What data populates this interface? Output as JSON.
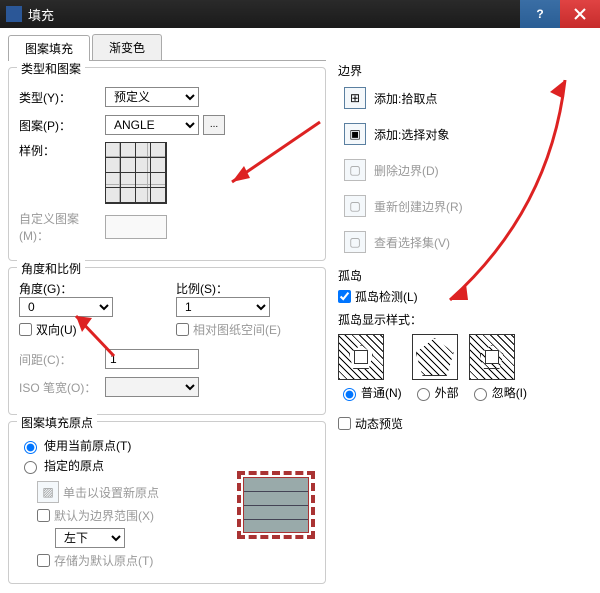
{
  "window": {
    "title": "填充"
  },
  "tabs": {
    "pattern": "图案填充",
    "gradient": "渐变色"
  },
  "group_type": {
    "title": "类型和图案",
    "type_label": "类型(Y)：",
    "type_value": "预定义",
    "pattern_label": "图案(P)：",
    "pattern_value": "ANGLE",
    "sample_label": "样例：",
    "custom_label": "自定义图案(M)："
  },
  "group_angle": {
    "title": "角度和比例",
    "angle_label": "角度(G)：",
    "angle_value": "0",
    "scale_label": "比例(S)：",
    "scale_value": "1",
    "bidir_label": "双向(U)",
    "paper_label": "相对图纸空间(E)",
    "spacing_label": "间距(C)：",
    "spacing_value": "1",
    "iso_label": "ISO 笔宽(O)："
  },
  "group_origin": {
    "title": "图案填充原点",
    "use_current": "使用当前原点(T)",
    "specified": "指定的原点",
    "click_set": "单击以设置新原点",
    "default_extents": "默认为边界范围(X)",
    "pos_value": "左下",
    "store_default": "存储为默认原点(T)"
  },
  "boundary": {
    "title": "边界",
    "add_pick": "添加:拾取点",
    "add_select": "添加:选择对象",
    "delete": "删除边界(D)",
    "recreate": "重新创建边界(R)",
    "view_sel": "查看选择集(V)"
  },
  "island": {
    "title": "孤岛",
    "detect": "孤岛检测(L)",
    "style_label": "孤岛显示样式：",
    "normal": "普通(N)",
    "outer": "外部",
    "ignore": "忽略(I)"
  },
  "dynamic_preview": "动态预览"
}
